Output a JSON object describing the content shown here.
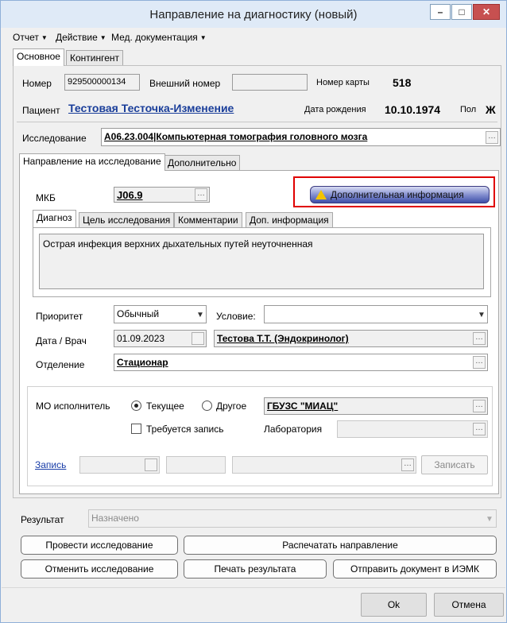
{
  "window": {
    "title": "Направление на диагностику (новый)",
    "minimize": "–",
    "maximize": "□",
    "close": "✕"
  },
  "menu": [
    "Отчет",
    "Действие",
    "Мед. документация"
  ],
  "top_tabs": [
    "Основное",
    "Контингент"
  ],
  "patient": {
    "number_label": "Номер",
    "number_value": "929500000134",
    "ext_number_label": "Внешний номер",
    "ext_number_value": "",
    "card_label": "Номер карты",
    "card_value": "518",
    "patient_label": "Пациент",
    "patient_name": "Тестовая Тесточка-Изменение",
    "dob_label": "Дата рождения",
    "dob_value": "10.10.1974",
    "sex_label": "Пол",
    "sex_value": "Ж"
  },
  "research": {
    "label": "Исследование",
    "value": "A06.23.004|Компьютерная томография головного мозга"
  },
  "inner_tabs": [
    "Направление на исследование",
    "Дополнительно"
  ],
  "mkb": {
    "label": "МКБ",
    "value": "J06.9",
    "info_button": "Дополнительная информация"
  },
  "diag_tabs": [
    "Диагноз",
    "Цель исследования",
    "Комментарии",
    "Доп. информация"
  ],
  "diagnosis_text": "Острая инфекция верхних дыхательных путей неуточненная",
  "priority": {
    "label": "Приоритет",
    "value": "Обычный",
    "condition_label": "Условие:",
    "condition_value": ""
  },
  "date_doctor": {
    "label": "Дата / Врач",
    "date": "01.09.2023",
    "doctor": "Тестова Т.Т. (Эндокринолог)"
  },
  "department": {
    "label": "Отделение",
    "value": "Стационар"
  },
  "mo": {
    "label": "МО исполнитель",
    "current": "Текущее",
    "other": "Другое",
    "value": "ГБУЗС \"МИАЦ\"",
    "requires_record": "Требуется запись",
    "lab_label": "Лаборатория",
    "lab_value": ""
  },
  "record": {
    "link": "Запись",
    "button": "Записать"
  },
  "result": {
    "label": "Результат",
    "value": "Назначено"
  },
  "actions": {
    "conduct": "Провести исследование",
    "print_direction": "Распечатать направление",
    "cancel_research": "Отменить исследование",
    "print_result": "Печать результата",
    "send_iemk": "Отправить документ в ИЭМК"
  },
  "footer": {
    "ok": "Ok",
    "cancel": "Отмена"
  },
  "colors": {
    "highlight_border": "#e00000",
    "info_button": "#3e4fa8",
    "link": "#1a3ea8"
  }
}
